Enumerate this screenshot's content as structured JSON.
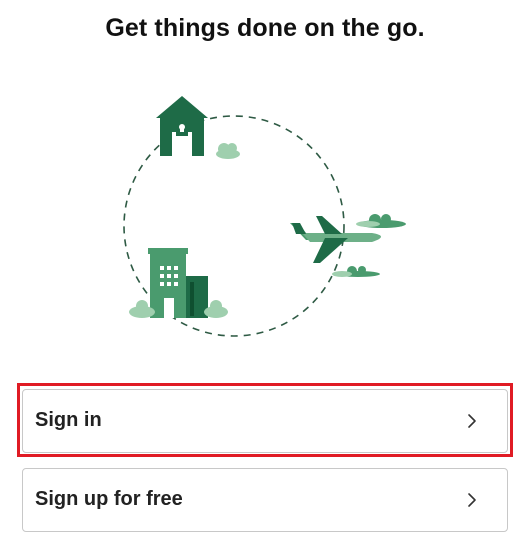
{
  "headline": "Get things done on the go.",
  "illustration": {
    "name": "travel-loop-illustration",
    "colors": {
      "dark_green": "#1e6b47",
      "mid_green": "#4a9b6e",
      "light_green": "#9fcfae",
      "dash": "#2e5a44"
    }
  },
  "options": {
    "sign_in_label": "Sign in",
    "sign_up_label": "Sign up for free"
  },
  "highlight_color": "#e01b24"
}
